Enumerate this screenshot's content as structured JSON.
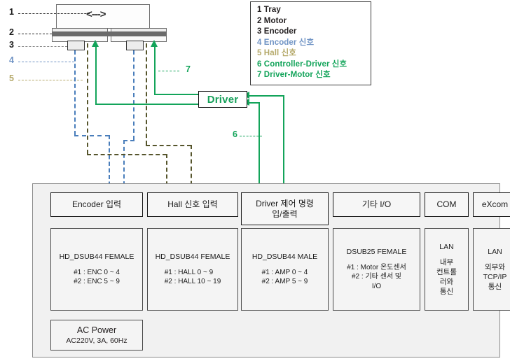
{
  "legend": {
    "items": [
      {
        "num": "1",
        "label": "Tray",
        "color": "#1a1a1a"
      },
      {
        "num": "2",
        "label": "Motor",
        "color": "#1a1a1a"
      },
      {
        "num": "3",
        "label": "Encoder",
        "color": "#1a1a1a"
      },
      {
        "num": "4",
        "label": "Encoder 신호",
        "color": "#6f93c4"
      },
      {
        "num": "5",
        "label": "Hall 신호",
        "color": "#b5a96a"
      },
      {
        "num": "6",
        "label": "Controller-Driver 신호",
        "color": "#13a45a"
      },
      {
        "num": "7",
        "label": "Driver-Motor 신호",
        "color": "#13a45a"
      }
    ]
  },
  "machine": {
    "tray_arrow": "<--->",
    "ref_labels": [
      {
        "num": "1",
        "color": "#1a1a1a"
      },
      {
        "num": "2",
        "color": "#1a1a1a"
      },
      {
        "num": "3",
        "color": "#1a1a1a"
      },
      {
        "num": "4",
        "color": "#6f93c4"
      },
      {
        "num": "5",
        "color": "#b5a96a"
      }
    ],
    "inline_labels": [
      {
        "num": "7",
        "color": "#13a45a"
      },
      {
        "num": "6",
        "color": "#13a45a"
      }
    ]
  },
  "driver": {
    "label": "Driver"
  },
  "chassis": {
    "ports": [
      {
        "title": "Encoder 입력"
      },
      {
        "title": "Hall 신호 입력"
      },
      {
        "title": "Driver 제어 명령\n입/출력"
      },
      {
        "title": "기타 I/O"
      },
      {
        "title": "COM"
      },
      {
        "title": "eXcom"
      }
    ],
    "connectors": [
      {
        "name": "HD_DSUB44 FEMALE",
        "detail": "#1 : ENC 0 ~ 4\n#2 : ENC 5 ~ 9"
      },
      {
        "name": "HD_DSUB44 FEMALE",
        "detail": "#1 : HALL 0 ~ 9\n#2 : HALL 10 ~ 19"
      },
      {
        "name": "HD_DSUB44 MALE",
        "detail": "#1 : AMP 0 ~ 4\n#2 : AMP 5 ~ 9"
      },
      {
        "name": "DSUB25 FEMALE",
        "detail": "#1 : Motor 온도센서\n#2 : 기타 센서 및\nI/O"
      },
      {
        "name": "LAN",
        "detail": "내부\n컨트롤\n러와\n통신"
      },
      {
        "name": "LAN",
        "detail": "외부와\nTCP/IP\n통신"
      }
    ],
    "power": {
      "title": "AC Power",
      "spec": "AC220V, 3A, 60Hz"
    }
  },
  "colors": {
    "encoder_signal": "#4a7ebb",
    "hall_signal": "#56552c",
    "driver_signal": "#13a45a",
    "chassis_bg": "#f1f1f1"
  }
}
